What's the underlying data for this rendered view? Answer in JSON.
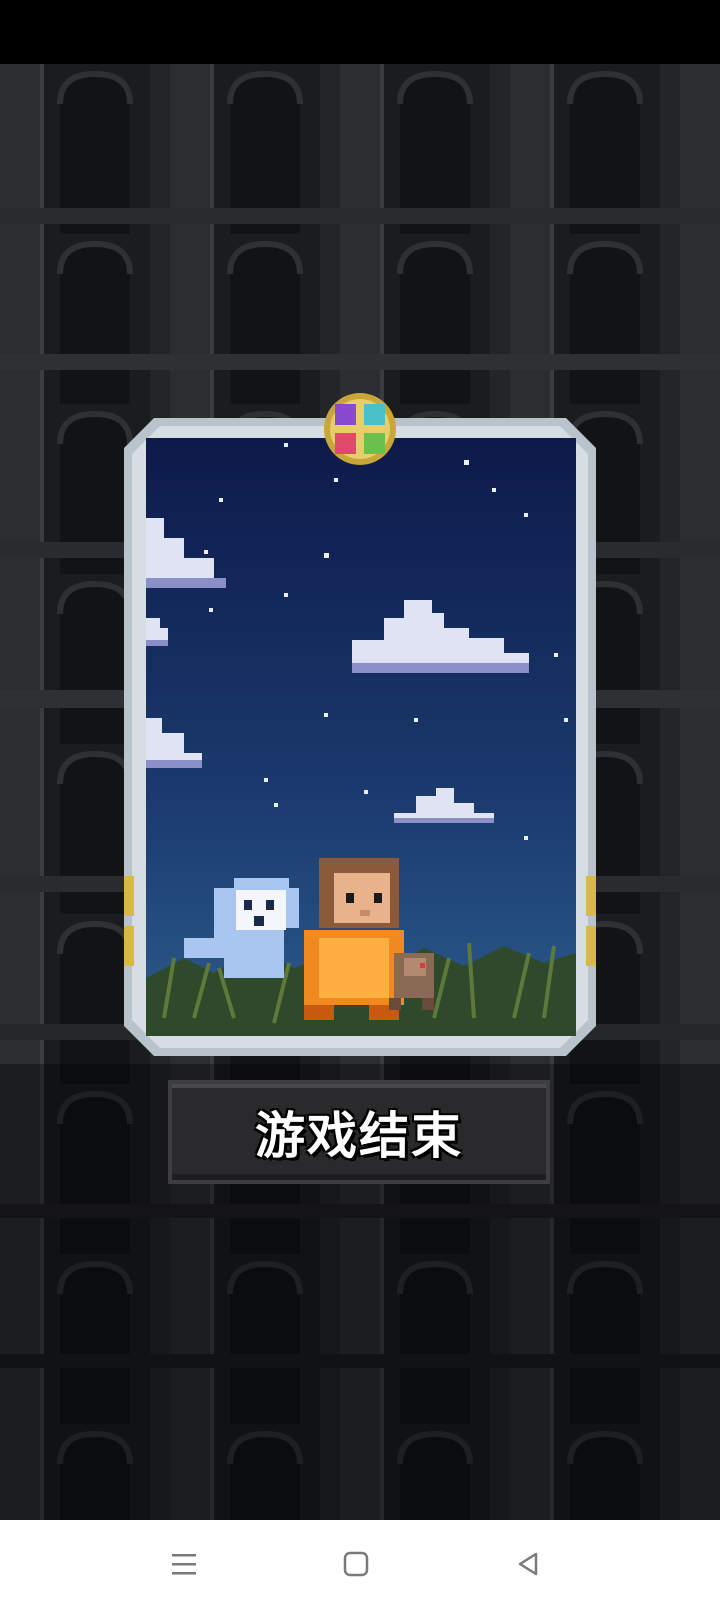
{
  "game": {
    "end_button_label": "游戏结束"
  },
  "card": {
    "scene": "night-sky-with-characters"
  },
  "nav": {
    "menu_icon": "menu-icon",
    "home_icon": "home-icon",
    "back_icon": "back-icon"
  },
  "colors": {
    "background": "#1c1d1f",
    "frame": "#b9c3cc",
    "sky_top": "#0d1a4a",
    "sky_bottom": "#2c5c8c",
    "button": "#2a2a2c",
    "nav_bar": "#ffffff"
  }
}
